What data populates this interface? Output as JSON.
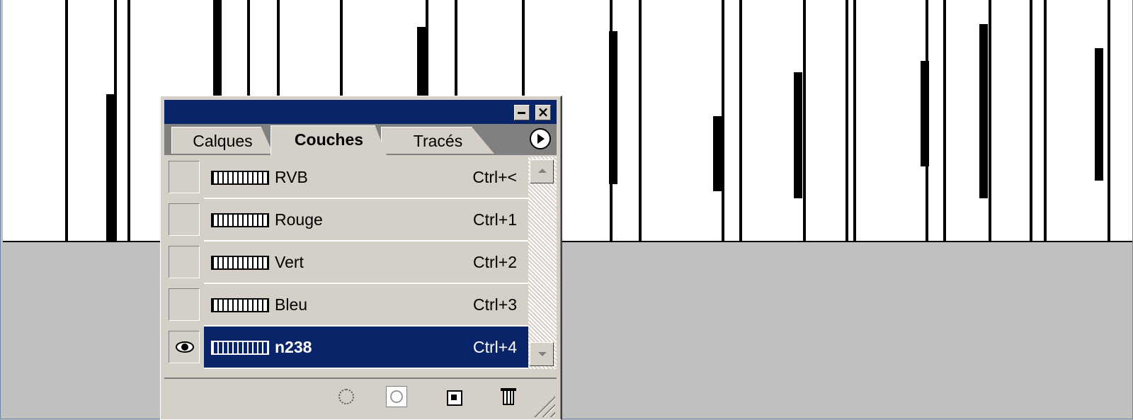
{
  "palette": {
    "tabs": [
      {
        "label": "Calques"
      },
      {
        "label": "Couches",
        "active": true
      },
      {
        "label": "Tracés"
      }
    ],
    "channels": [
      {
        "name": "RVB",
        "shortcut": "Ctrl+<",
        "visible": false,
        "selected": false
      },
      {
        "name": "Rouge",
        "shortcut": "Ctrl+1",
        "visible": false,
        "selected": false
      },
      {
        "name": "Vert",
        "shortcut": "Ctrl+2",
        "visible": false,
        "selected": false
      },
      {
        "name": "Bleu",
        "shortcut": "Ctrl+3",
        "visible": false,
        "selected": false
      },
      {
        "name": "n238",
        "shortcut": "Ctrl+4",
        "visible": true,
        "selected": true
      }
    ],
    "bottom_icons": [
      "load-selection-icon",
      "save-selection-icon",
      "new-channel-icon",
      "trash-icon"
    ]
  },
  "colors": {
    "title_bar": "#0a246a",
    "selection": "#0a246a",
    "panel_bg": "#d4d0c8",
    "workspace_bg": "#c0c0c0"
  }
}
